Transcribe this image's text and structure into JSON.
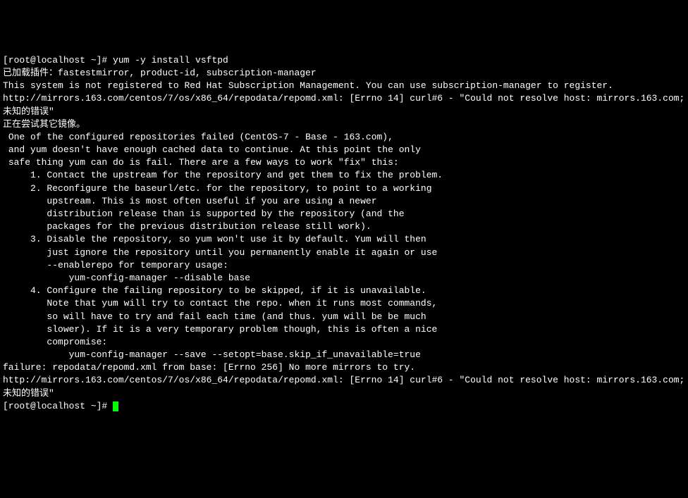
{
  "terminal": {
    "prompt": "[root@localhost ~]# ",
    "command": "yum -y install vsftpd",
    "lines": [
      "已加载插件：fastestmirror, product-id, subscription-manager",
      "This system is not registered to Red Hat Subscription Management. You can use subscription-manager to register.",
      "http://mirrors.163.com/centos/7/os/x86_64/repodata/repomd.xml: [Errno 14] curl#6 - \"Could not resolve host: mirrors.163.com; 未知的错误\"",
      "正在尝试其它镜像。",
      "",
      "",
      " One of the configured repositories failed (CentOS-7 - Base - 163.com),",
      " and yum doesn't have enough cached data to continue. At this point the only",
      " safe thing yum can do is fail. There are a few ways to work \"fix\" this:",
      "",
      "     1. Contact the upstream for the repository and get them to fix the problem.",
      "",
      "     2. Reconfigure the baseurl/etc. for the repository, to point to a working",
      "        upstream. This is most often useful if you are using a newer",
      "        distribution release than is supported by the repository (and the",
      "        packages for the previous distribution release still work).",
      "",
      "     3. Disable the repository, so yum won't use it by default. Yum will then",
      "        just ignore the repository until you permanently enable it again or use",
      "        --enablerepo for temporary usage:",
      "",
      "            yum-config-manager --disable base",
      "",
      "     4. Configure the failing repository to be skipped, if it is unavailable.",
      "        Note that yum will try to contact the repo. when it runs most commands,",
      "        so will have to try and fail each time (and thus. yum will be be much",
      "        slower). If it is a very temporary problem though, this is often a nice",
      "        compromise:",
      "",
      "            yum-config-manager --save --setopt=base.skip_if_unavailable=true",
      "",
      "failure: repodata/repomd.xml from base: [Errno 256] No more mirrors to try.",
      "http://mirrors.163.com/centos/7/os/x86_64/repodata/repomd.xml: [Errno 14] curl#6 - \"Could not resolve host: mirrors.163.com; 未知的错误\""
    ]
  }
}
